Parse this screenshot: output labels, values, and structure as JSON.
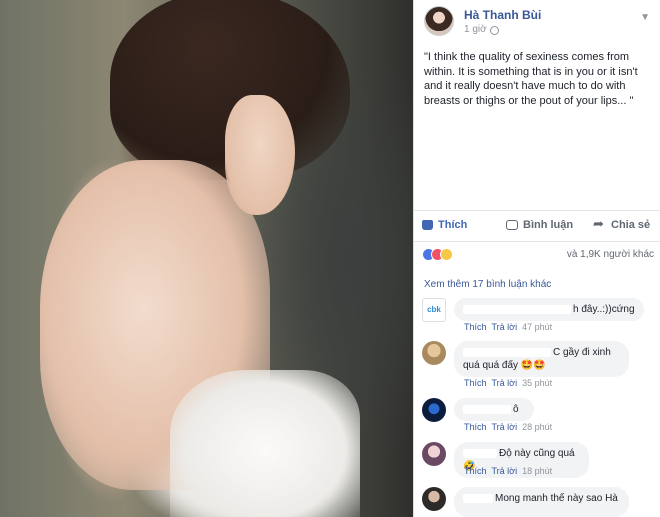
{
  "post": {
    "author": "Hà Thanh Bùi",
    "time": "1 giờ",
    "text": "\"I think the quality of sexiness comes from within. It is something that is in you or it isn't and it really doesn't have much to do with breasts or thighs or the pout of your lips... \""
  },
  "actions": {
    "like": "Thích",
    "comment": "Bình luận",
    "share": "Chia sẻ"
  },
  "reactions": {
    "summary": "và 1,9K người khác"
  },
  "comments_link": "Xem thêm 17 bình luận khác",
  "comments": [
    {
      "avatar": "cbk",
      "text": "h đây..:))cứng",
      "like": "Thích",
      "reply": "Trả lời",
      "time": "47 phút"
    },
    {
      "avatar": "",
      "text": "C gầy đi xinh quá quá đấy 🤩🤩",
      "like": "Thích",
      "reply": "Trả lời",
      "time": "35 phút"
    },
    {
      "avatar": "",
      "text": "ô",
      "like": "Thích",
      "reply": "Trả lời",
      "time": "28 phút"
    },
    {
      "avatar": "",
      "text": "Độ này cũng quá 🤣",
      "like": "Thích",
      "reply": "Trả lời",
      "time": "18 phút"
    },
    {
      "avatar": "",
      "text": "Mong manh thế này sao Hà"
    }
  ]
}
